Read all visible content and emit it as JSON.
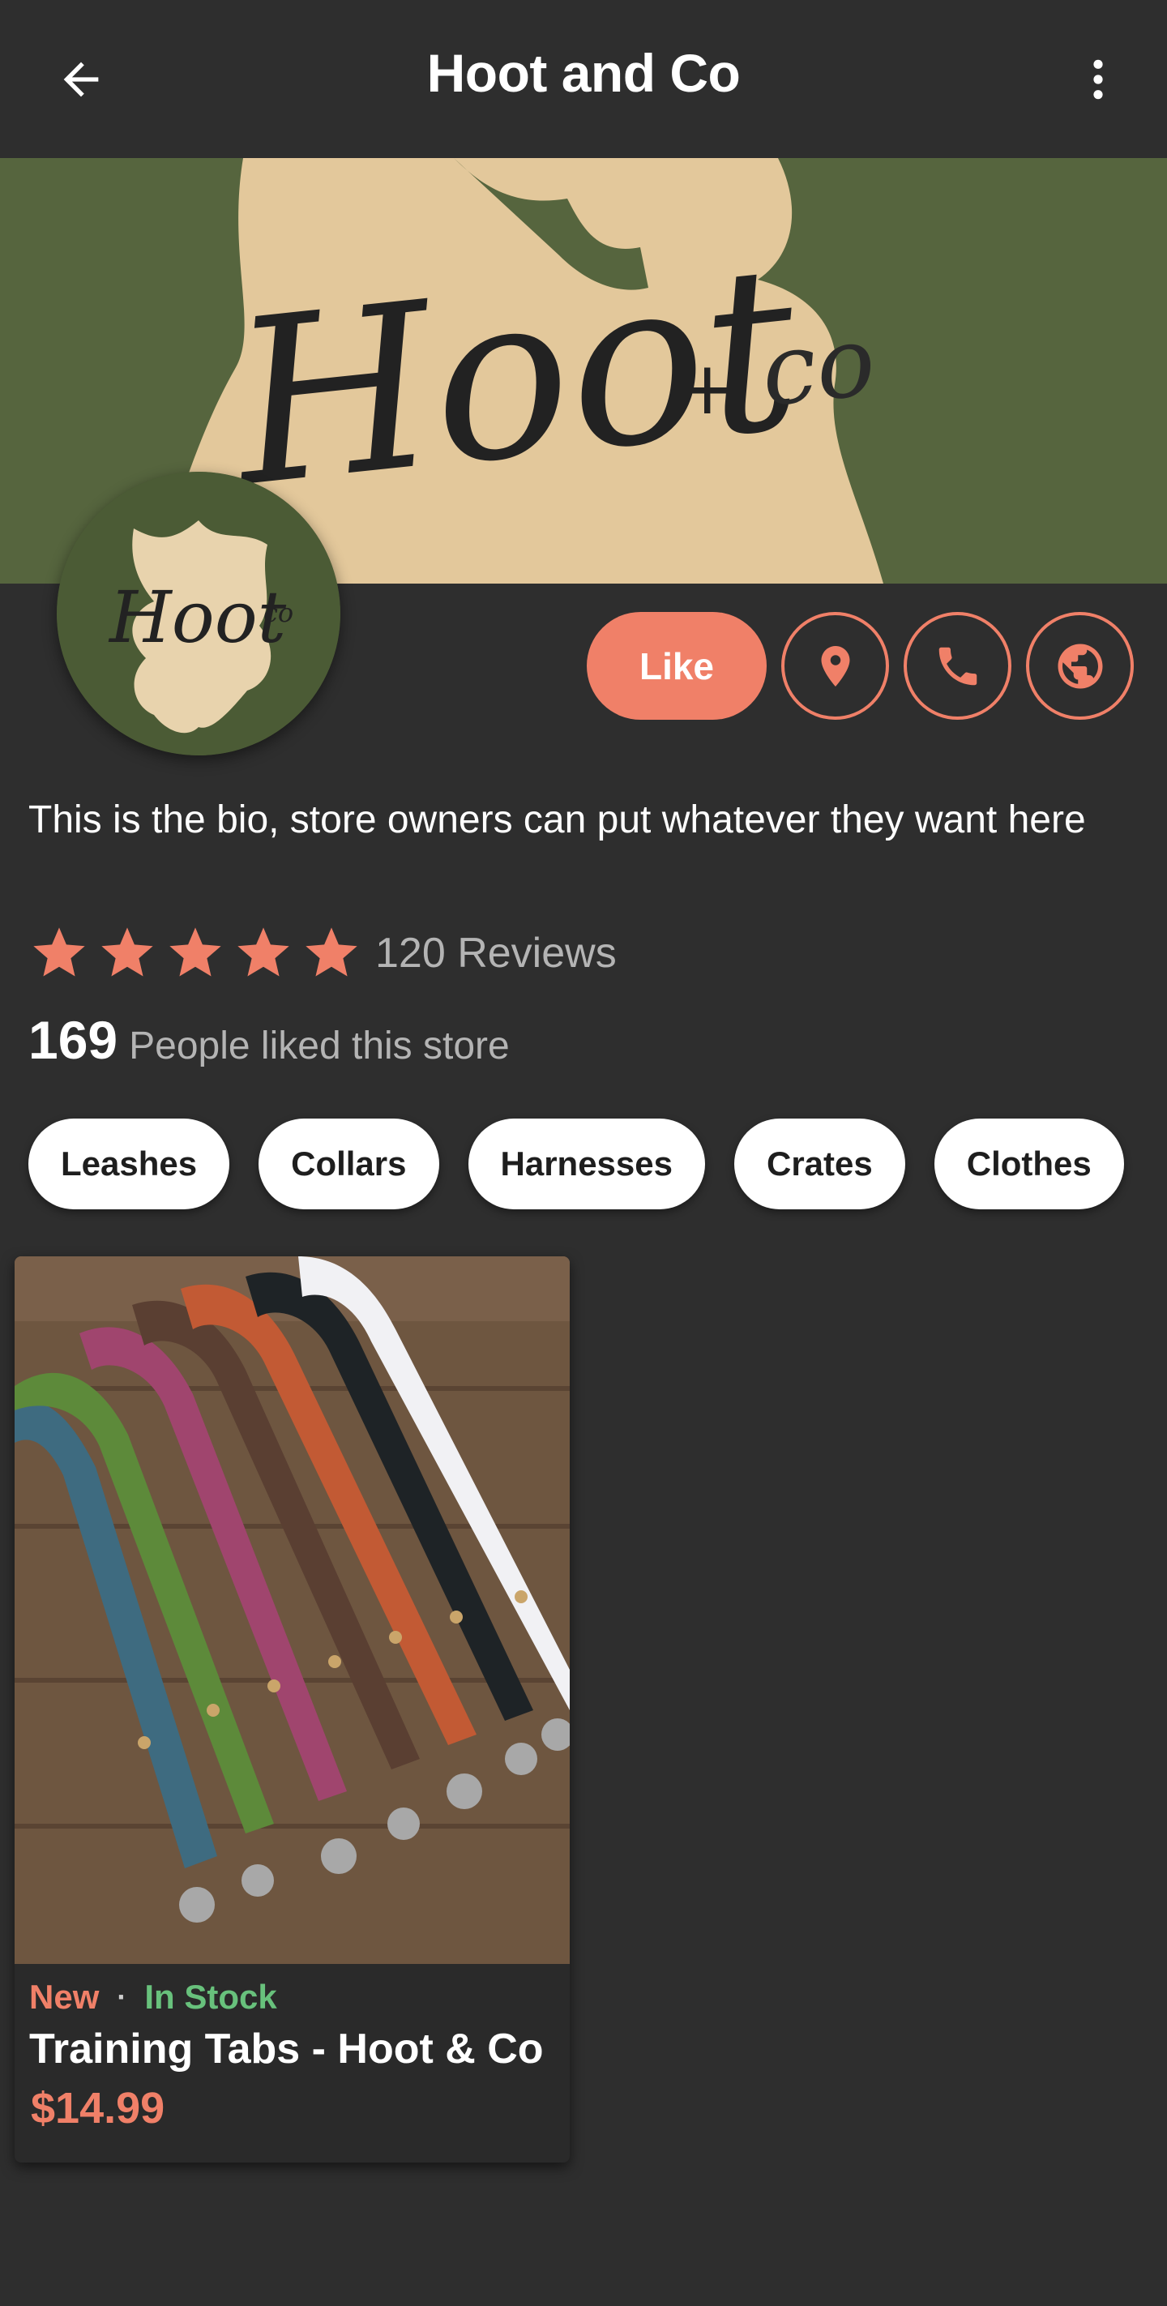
{
  "header": {
    "title": "Hoot and Co",
    "back_icon": "arrow-left-icon",
    "more_icon": "more-vertical-icon"
  },
  "banner": {
    "logo_text": "Hoot",
    "logo_suffix": "co"
  },
  "avatar": {
    "logo_text": "Hoot",
    "logo_suffix": "co"
  },
  "actions": {
    "like_label": "Like",
    "location_icon": "map-pin-icon",
    "phone_icon": "phone-icon",
    "website_icon": "globe-icon"
  },
  "bio": "This is the bio, store owners can put whatever they want here",
  "rating": {
    "stars": 5,
    "reviews_label": "120 Reviews"
  },
  "likes": {
    "count": "169",
    "label": "People liked this store"
  },
  "categories": [
    "Leashes",
    "Collars",
    "Harnesses",
    "Crates",
    "Clothes"
  ],
  "product": {
    "badge_new": "New",
    "separator": "·",
    "stock": "In Stock",
    "name": "Training Tabs - Hoot & Co",
    "price": "$14.99"
  },
  "colors": {
    "accent": "#f08068",
    "stock_green": "#68c17c",
    "background": "#2e2e2e",
    "banner_green": "#56653e",
    "banner_tan": "#e3c89b"
  }
}
